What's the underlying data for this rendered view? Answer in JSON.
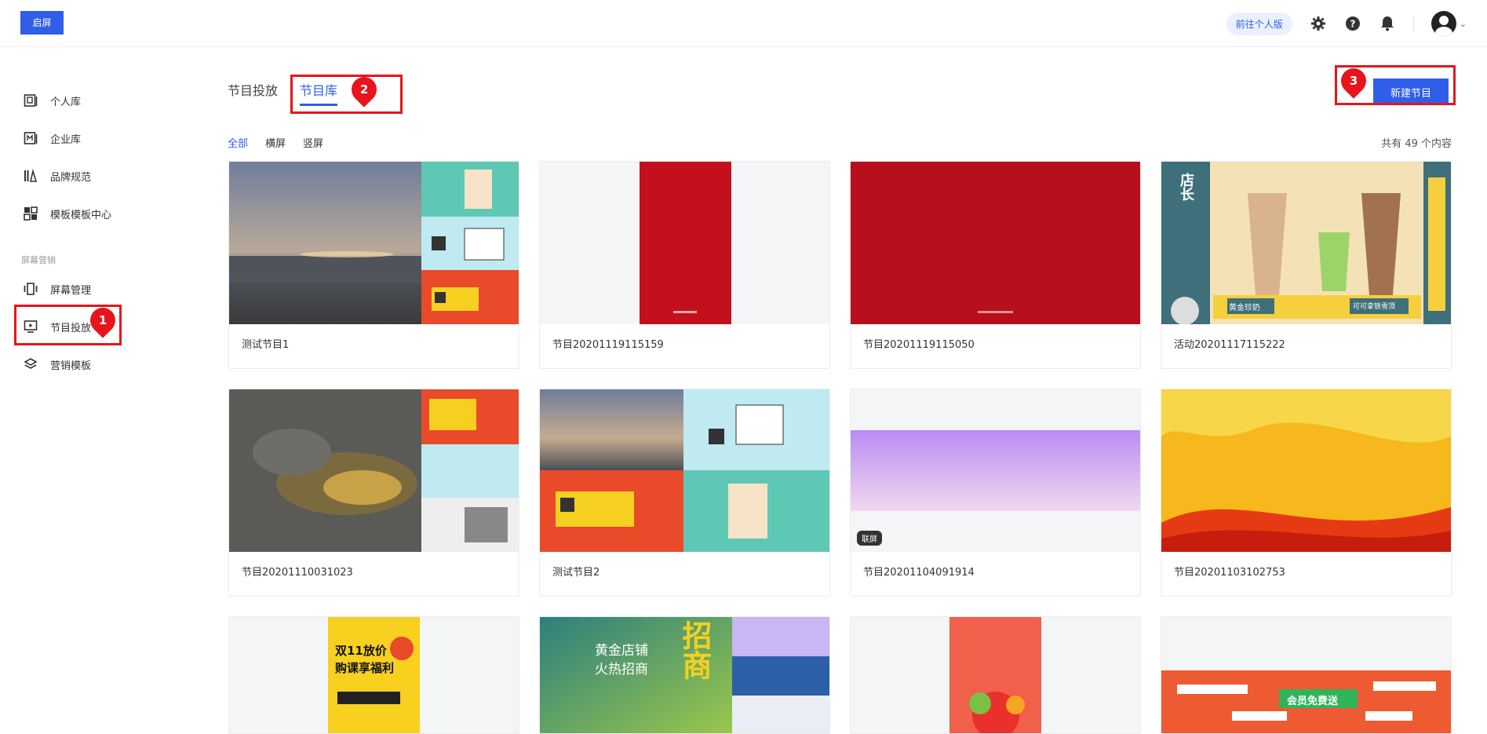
{
  "header": {
    "logo_text": "启屏",
    "personal_link": "前往个人版",
    "icons": [
      "gear-icon",
      "help-icon",
      "bell-icon",
      "avatar"
    ]
  },
  "sidebar": {
    "items": [
      {
        "label": "个人库",
        "icon": "personal-library-icon"
      },
      {
        "label": "企业库",
        "icon": "enterprise-library-icon"
      },
      {
        "label": "品牌规范",
        "icon": "brand-guide-icon"
      },
      {
        "label": "模板模板中心",
        "icon": "template-center-icon"
      }
    ],
    "group_title": "屏幕营销",
    "group_items": [
      {
        "label": "屏幕管理",
        "icon": "screen-icon"
      },
      {
        "label": "节目投放",
        "icon": "program-play-icon"
      },
      {
        "label": "营销模板",
        "icon": "layers-icon"
      }
    ]
  },
  "main": {
    "tabs": [
      {
        "label": "节目投放",
        "active": false
      },
      {
        "label": "节目库",
        "active": true
      }
    ],
    "filters": [
      {
        "label": "全部",
        "active": true
      },
      {
        "label": "横屏",
        "active": false
      },
      {
        "label": "竖屏",
        "active": false
      }
    ],
    "count_text": "共有 49 个内容",
    "new_button": "新建节目",
    "cards": [
      {
        "title": "测试节目1"
      },
      {
        "title": "节目20201119115159"
      },
      {
        "title": "节目20201119115050"
      },
      {
        "title": "活动20201117115222"
      },
      {
        "title": "节目20201110031023"
      },
      {
        "title": "测试节目2"
      },
      {
        "title": "节目20201104091914"
      },
      {
        "title": "节目20201103102753"
      },
      {
        "title": ""
      },
      {
        "title": ""
      },
      {
        "title": ""
      },
      {
        "title": ""
      }
    ],
    "thumb_texts": {
      "c4_left": "店长",
      "c4_mid_left": "黄金珍奶",
      "c4_mid_right": "可可拿铁雪顶",
      "c7_badge": "联屏",
      "c9_text1": "双11放价",
      "c9_text2": "购课享福利",
      "c10_text1": "黄金店铺",
      "c10_text2": "火热招商",
      "c10_big": "招商",
      "c12_btn": "会员免费送"
    }
  },
  "annotations": [
    {
      "label": "1"
    },
    {
      "label": "2"
    },
    {
      "label": "3"
    }
  ],
  "colors": {
    "accent": "#2f5fe8",
    "highlight": "#e8141c"
  }
}
